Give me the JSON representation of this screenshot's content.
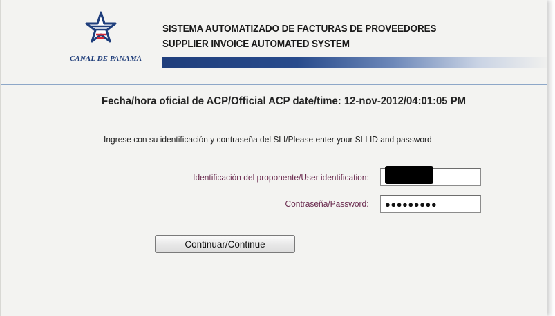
{
  "header": {
    "logo_text": "CANAL DE PANAMÁ",
    "title_es": "SISTEMA AUTOMATIZADO DE FACTURAS DE PROVEEDORES",
    "title_en": "SUPPLIER INVOICE AUTOMATED SYSTEM"
  },
  "official_datetime": "Fecha/hora oficial de ACP/Official ACP date/time: 12-nov-2012/04:01:05 PM",
  "instructions": "Ingrese con su identificación y contraseña del SLI/Please enter your SLI ID and password",
  "form": {
    "user_label": "Identificación del proponente/User identification:",
    "user_value": "",
    "password_label": "Contraseña/Password:",
    "password_mask": "●●●●●●●●●",
    "submit_label": "Continuar/Continue"
  },
  "colors": {
    "brand_blue": "#1f3e7c",
    "brand_red": "#d62a36",
    "label_color": "#6a2a4e",
    "panel_bg": "#f3f3f1"
  },
  "icons": {
    "logo": "canal-de-panama-star-logo"
  }
}
